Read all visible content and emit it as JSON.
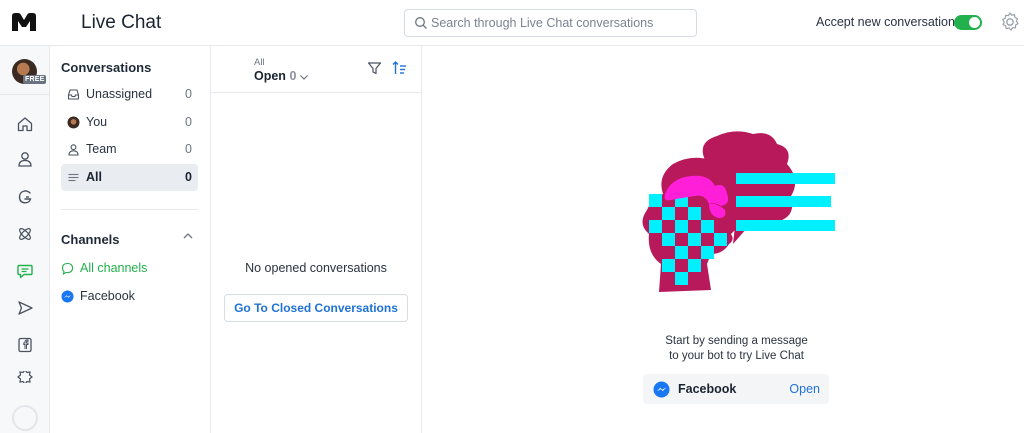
{
  "header": {
    "title": "Live Chat",
    "search_placeholder": "Search through Live Chat conversations",
    "accept_label": "Accept new conversations",
    "accept_enabled": true
  },
  "account": {
    "plan_badge": "FREE"
  },
  "rail": {
    "items": [
      "home-icon",
      "user-icon",
      "growth-tools-icon",
      "integrations-icon",
      "live-chat-icon",
      "send-icon",
      "facebook-page-icon",
      "settings-partial-icon"
    ],
    "active": "live-chat-icon"
  },
  "conversations": {
    "heading": "Conversations",
    "items": [
      {
        "label": "Unassigned",
        "count": "0",
        "icon": "inbox-icon"
      },
      {
        "label": "You",
        "count": "0",
        "icon": "user-avatar-icon"
      },
      {
        "label": "Team",
        "count": "0",
        "icon": "team-icon"
      },
      {
        "label": "All",
        "count": "0",
        "icon": "list-icon",
        "active": true
      }
    ]
  },
  "channels": {
    "heading": "Channels",
    "items": [
      {
        "label": "All channels",
        "icon": "chat-bubble-icon",
        "color": "#22b14c"
      },
      {
        "label": "Facebook",
        "icon": "messenger-icon"
      }
    ]
  },
  "list": {
    "filter_group": "All",
    "status": "Open",
    "status_count": "0",
    "empty_text": "No opened conversations",
    "closed_button": "Go To Closed Conversations"
  },
  "main": {
    "message_line1": "Start by sending a message",
    "message_line2": "to your bot to try Live Chat",
    "channel_card": {
      "label": "Facebook",
      "action": "Open"
    }
  },
  "colors": {
    "accent_blue": "#1f72d6",
    "toggle_green": "#22b14c",
    "illustration_magenta": "#b8195a",
    "illustration_cyan": "#00f0ff",
    "illustration_pink": "#ff1fd9"
  }
}
